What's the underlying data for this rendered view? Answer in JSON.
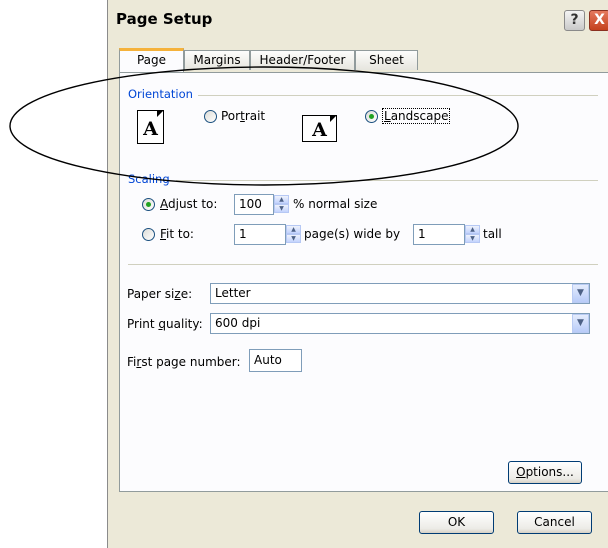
{
  "window": {
    "title": "Page Setup",
    "help_glyph": "?",
    "close_glyph": "X"
  },
  "tabs": [
    {
      "label": "Page",
      "active": true
    },
    {
      "label": "Margins",
      "active": false
    },
    {
      "label": "Header/Footer",
      "active": false
    },
    {
      "label": "Sheet",
      "active": false
    }
  ],
  "orientation": {
    "group_label": "Orientation",
    "icon_letter": "A",
    "portrait": {
      "label": "Portrait",
      "selected": false
    },
    "landscape": {
      "label": "Landscape",
      "selected": true
    }
  },
  "scaling": {
    "group_label": "Scaling",
    "adjust_to": {
      "label": "Adjust to:",
      "value": "100",
      "suffix": "% normal size",
      "selected": true
    },
    "fit_to": {
      "label": "Fit to:",
      "wide_value": "1",
      "wide_suffix": "page(s) wide by",
      "tall_value": "1",
      "tall_suffix": "tall",
      "selected": false
    }
  },
  "paper_size": {
    "label": "Paper size:",
    "value": "Letter"
  },
  "print_quality": {
    "label": "Print quality:",
    "value": "600 dpi"
  },
  "first_page_number": {
    "label": "First page number:",
    "value": "Auto"
  },
  "buttons": {
    "options": "Options...",
    "ok": "OK",
    "cancel": "Cancel"
  },
  "colors": {
    "group_label": "#0046d5",
    "tab_highlight": "#f5b23b",
    "dialog_bg": "#ece9d8",
    "radio_selected": "#21a121"
  }
}
